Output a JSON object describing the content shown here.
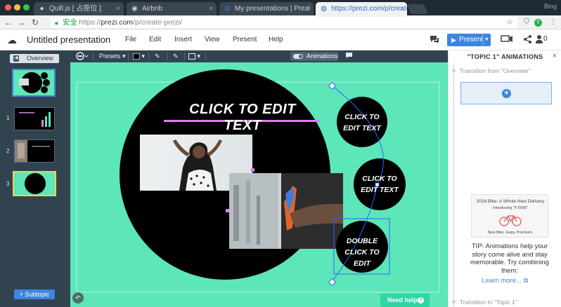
{
  "browser": {
    "tabs": [
      {
        "title": "Quill.js [ 占座位 ]",
        "icon": "github-icon"
      },
      {
        "title": "Airbnb",
        "icon": "location-pin-icon"
      },
      {
        "title": "My presentations | Prezi",
        "icon": "prezi-icon"
      },
      {
        "title": "https://prezi.com/p/create",
        "icon": "globe-icon"
      }
    ],
    "active_tab_index": 3,
    "user_label": "Bing",
    "secure_label": "安全",
    "url_prefix": "https://",
    "url_host": "prezi.com",
    "url_path": "/p/create-prezi/"
  },
  "header": {
    "title": "Untitled presentation",
    "menus": [
      "File",
      "Edit",
      "Insert",
      "View",
      "Present",
      "Help"
    ],
    "present_label": "Present",
    "user_count": "0"
  },
  "toolbar": {
    "presets_label": "Presets",
    "animations_label": "Animations"
  },
  "sidebar": {
    "overview_label": "Overview",
    "slides": [
      {
        "number": "1"
      },
      {
        "number": "2"
      },
      {
        "number": "3"
      }
    ],
    "subtopic_label": "+ Subtopic"
  },
  "canvas": {
    "title_text": "CLICK TO EDIT TEXT",
    "bubbles": [
      "CLICK TO EDIT TEXT",
      "CLICK TO EDIT TEXT",
      "DOUBLE CLICK TO EDIT"
    ],
    "need_help_label": "Need help",
    "colors": {
      "background": "#5de6b9",
      "circle": "#000000",
      "accent": "#e07bf0",
      "selection": "#2a66ff"
    }
  },
  "panel": {
    "title": "\"TOPIC 1\" ANIMATIONS",
    "transition_from": "Transition from \"Overview\"",
    "tip_image_title": "2016 Bike: A Whole New Delivery",
    "tip_image_subtitle": "Introducing \"F-5000\"",
    "tip_image_caption": "New Bike. Easy. Premium.",
    "tip_text": "TIP: Animations help your story come alive and stay memorable. Try combining them:",
    "learn_more": "Learn more...",
    "transition_to": "Transition to \"Topic 1\""
  }
}
